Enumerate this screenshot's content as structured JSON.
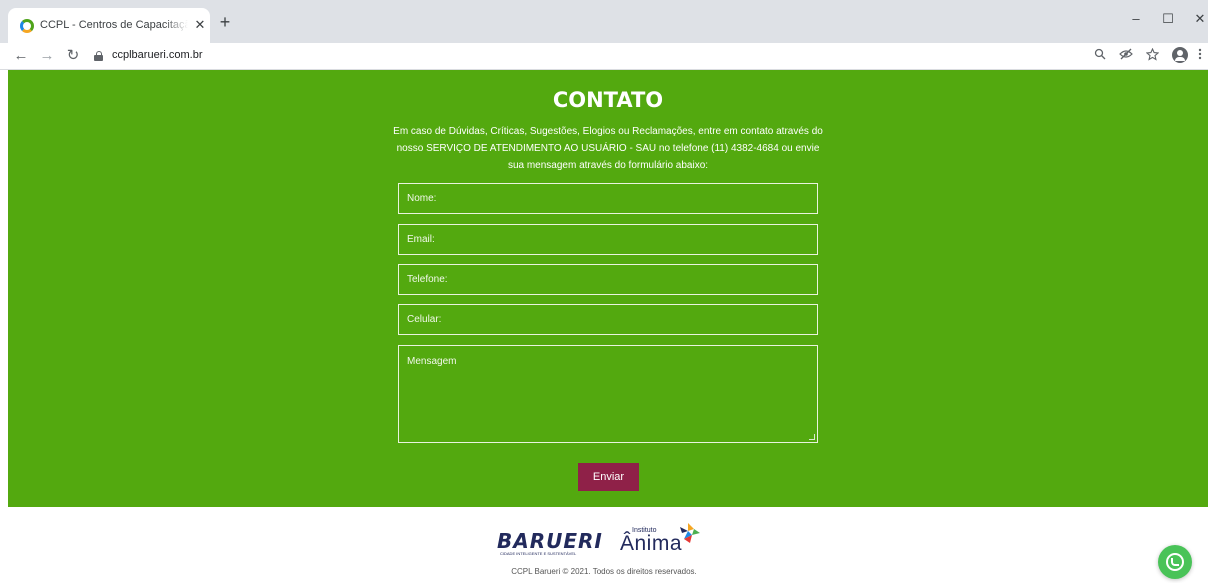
{
  "browser": {
    "tab_title": "CCPL - Centros de Capacitação P",
    "tab_close": "✕",
    "new_tab": "+",
    "url": "ccplbarueri.com.br",
    "window_controls": {
      "minimize": "–",
      "maximize": "☐",
      "close": "✕"
    },
    "nav": {
      "back": "←",
      "forward": "→",
      "reload": "↻"
    },
    "toolbar_icons": [
      "zoom-icon",
      "eye-off-icon",
      "star-icon",
      "profile-icon",
      "menu-icon"
    ]
  },
  "contact": {
    "heading": "CONTATO",
    "intro": "Em caso de Dúvidas, Críticas, Sugestões, Elogios ou Reclamações, entre em contato através do nosso SERVIÇO DE ATENDIMENTO AO USUÁRIO - SAU no telefone (11) 4382-4684 ou envie sua mensagem através do formulário abaixo:",
    "fields": {
      "name": "Nome:",
      "email": "Email:",
      "phone": "Telefone:",
      "mobile": "Celular:",
      "message": "Mensagem"
    },
    "submit_label": "Enviar"
  },
  "footer": {
    "barueri_logo": "BARUERI",
    "barueri_tagline": "CIDADE INTELIGENTE E SUSTENTÁVEL",
    "anima_prefix": "Instituto",
    "anima_logo": "Ânima",
    "copyright": "CCPL Barueri © 2021. Todos os direitos reservados."
  },
  "colors": {
    "page_green": "#53a90f",
    "button": "#8f2148",
    "brand_navy": "#222a5c",
    "whatsapp": "#49c358"
  }
}
